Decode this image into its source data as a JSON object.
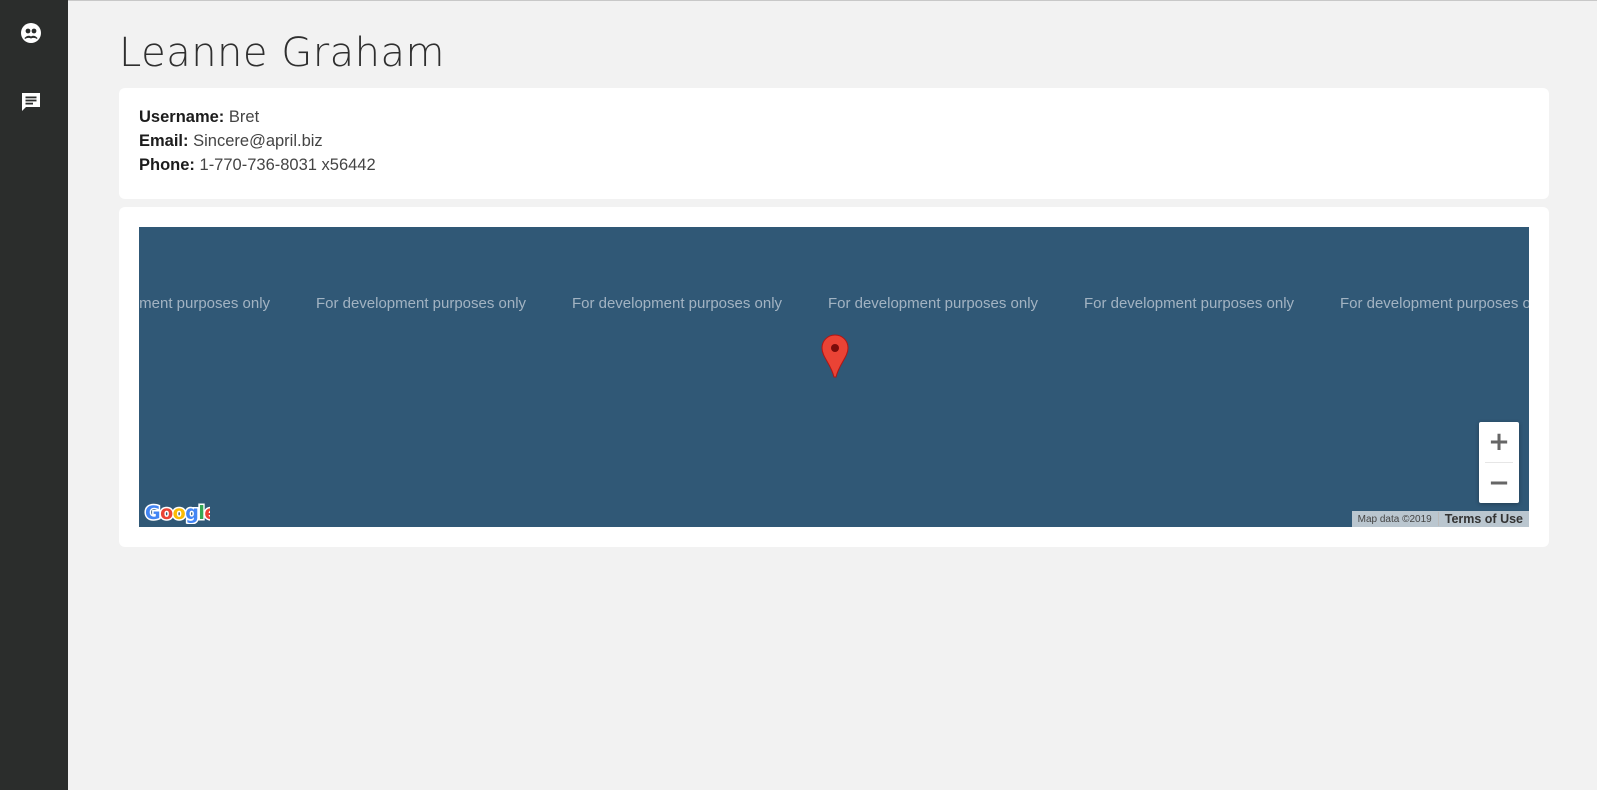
{
  "sidebar": {
    "items": [
      {
        "icon": "users-icon"
      },
      {
        "icon": "message-icon"
      }
    ]
  },
  "profile": {
    "name": "Leanne Graham",
    "fields": [
      {
        "label": "Username:",
        "value": "Bret"
      },
      {
        "label": "Email:",
        "value": "Sincere@april.biz"
      },
      {
        "label": "Phone:",
        "value": "1-770-736-8031 x56442"
      }
    ]
  },
  "map": {
    "watermark": "For development purposes only",
    "zoom_in": "+",
    "zoom_out": "−",
    "logo": "Google",
    "attribution": "Map data ©2019",
    "terms": "Terms of Use",
    "colors": {
      "background": "#305876",
      "pin": "#ea4335"
    }
  },
  "colors": {
    "sidebar": "#2b2d2c",
    "page_background": "#f2f2f2",
    "card": "#ffffff"
  }
}
